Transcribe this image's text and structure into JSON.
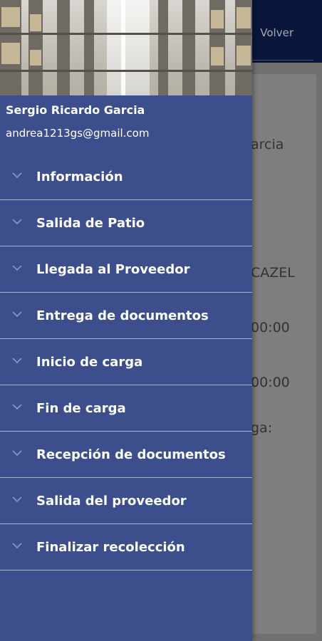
{
  "header": {
    "back_label": "Volver"
  },
  "card": {
    "lines": [
      "arcia",
      "CAZEL",
      "00:00",
      "00:00",
      "ga:"
    ]
  },
  "user": {
    "name": "Sergio Ricardo Garcia",
    "email": "andrea1213gs@gmail.com"
  },
  "menu": {
    "items": [
      {
        "label": "Información"
      },
      {
        "label": "Salida de Patio"
      },
      {
        "label": "Llegada al Proveedor"
      },
      {
        "label": "Entrega de documentos"
      },
      {
        "label": "Inicio de carga"
      },
      {
        "label": "Fin de carga"
      },
      {
        "label": "Recepción de documentos"
      },
      {
        "label": "Salida del proveedor"
      },
      {
        "label": "Finalizar recolección"
      }
    ],
    "icon": "chevron-down-icon"
  },
  "colors": {
    "drawer": "#3c4e8c",
    "header": "#0d1a4a",
    "divider": "#aab4d4"
  }
}
